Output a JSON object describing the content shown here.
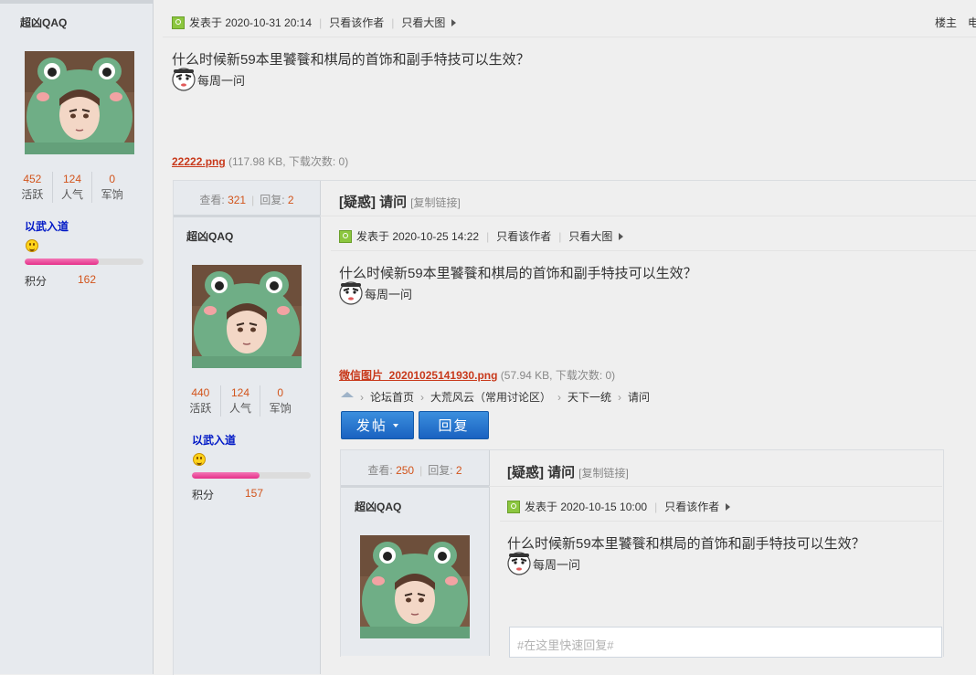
{
  "floor_label": "楼主",
  "floor_extra": "电",
  "posts": [
    {
      "user": {
        "name": "超凶QAQ",
        "stats": [
          {
            "num": "452",
            "label": "活跃"
          },
          {
            "num": "124",
            "label": "人气"
          },
          {
            "num": "0",
            "label": "军饷"
          }
        ],
        "rank": "以武入道",
        "score_label": "积分",
        "score": "162",
        "progress": 0.62
      },
      "posted": "发表于 2020-10-31 20:14",
      "only_author": "只看该作者",
      "big_image": "只看大图",
      "question": "什么时候新59本里饕餮和棋局的首饰和副手特技可以生效？",
      "weekly": "每周一问",
      "attachment": {
        "name": "22222.png",
        "info": "(117.98 KB, 下载次数: 0)"
      }
    },
    {
      "thread": {
        "views_label": "查看:",
        "views": "321",
        "replies_label": "回复:",
        "replies": "2",
        "title": "[疑惑] 请问",
        "copy_link": "[复制链接]"
      },
      "user": {
        "name": "超凶QAQ",
        "stats": [
          {
            "num": "440",
            "label": "活跃"
          },
          {
            "num": "124",
            "label": "人气"
          },
          {
            "num": "0",
            "label": "军饷"
          }
        ],
        "rank": "以武入道",
        "score_label": "积分",
        "score": "157",
        "progress": 0.57
      },
      "posted": "发表于 2020-10-25 14:22",
      "only_author": "只看该作者",
      "big_image": "只看大图",
      "question": "什么时候新59本里饕餮和棋局的首饰和副手特技可以生效？",
      "weekly": "每周一问",
      "attachment": {
        "name": "微信图片_20201025141930.png",
        "info": "(57.94 KB, 下载次数: 0)"
      }
    },
    {
      "thread": {
        "views_label": "查看:",
        "views": "250",
        "replies_label": "回复:",
        "replies": "2",
        "title": "[疑惑] 请问",
        "copy_link": "[复制链接]"
      },
      "user": {
        "name": "超凶QAQ"
      },
      "posted": "发表于 2020-10-15 10:00",
      "only_author": "只看该作者",
      "question": "什么时候新59本里饕餮和棋局的首饰和副手特技可以生效？",
      "weekly": "每周一问"
    }
  ],
  "breadcrumb": [
    "论坛首页",
    "大荒风云（常用讨论区）",
    "天下一统",
    "请问"
  ],
  "buttons": {
    "post": "发帖",
    "reply": "回复"
  },
  "quick_reply": {
    "placeholder": "#在这里快速回复#"
  },
  "colors": {
    "accent": "#1a62c1",
    "link": "#c8391b",
    "number": "#d2541b",
    "rank": "#0018c6"
  }
}
